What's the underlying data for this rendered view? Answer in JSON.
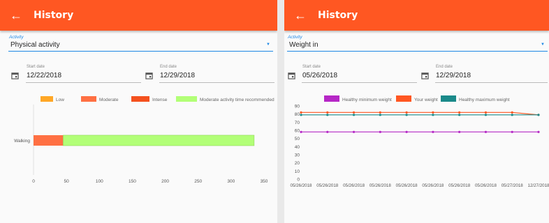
{
  "left": {
    "title": "History",
    "activity_label": "Activity",
    "activity_value": "Physical activity",
    "start_label": "Start date",
    "start_value": "12/22/2018",
    "end_label": "End date",
    "end_value": "12/29/2018",
    "chart_data": {
      "type": "bar",
      "orientation": "horizontal",
      "stacked": true,
      "categories": [
        "Walking"
      ],
      "series": [
        {
          "name": "Low",
          "color": "#ffa726",
          "values": [
            0
          ]
        },
        {
          "name": "Moderate",
          "color": "#ff7043",
          "values": [
            45
          ]
        },
        {
          "name": "Intense",
          "color": "#f4511e",
          "values": [
            0
          ]
        },
        {
          "name": "Moderate activity time recommended",
          "color": "#b2ff77",
          "values": [
            290
          ]
        }
      ],
      "xlim": [
        0,
        350
      ],
      "xticks": [
        0,
        50,
        100,
        150,
        200,
        250,
        300,
        350
      ]
    }
  },
  "right": {
    "title": "History",
    "activity_label": "Activity",
    "activity_value": "Weight in",
    "start_label": "Start date",
    "start_value": "05/26/2018",
    "end_label": "End date",
    "end_value": "12/29/2018",
    "chart_data": {
      "type": "line",
      "categories": [
        "05/26/2018",
        "05/26/2018",
        "05/26/2018",
        "05/26/2018",
        "05/26/2018",
        "05/26/2018",
        "05/26/2018",
        "05/26/2018",
        "05/27/2018",
        "12/27/2018"
      ],
      "series": [
        {
          "name": "Healthy minimum weight",
          "color": "#b627c6",
          "values": [
            58,
            58,
            58,
            58,
            58,
            58,
            58,
            58,
            58,
            58
          ]
        },
        {
          "name": "Your weight",
          "color": "#ff5722",
          "values": [
            82,
            82,
            82,
            82,
            82,
            82,
            82,
            82,
            82,
            79
          ]
        },
        {
          "name": "Healthy maximum weight",
          "color": "#1a8a8a",
          "values": [
            79,
            79,
            79,
            79,
            79,
            79,
            79,
            79,
            79,
            79
          ]
        }
      ],
      "ylim": [
        0,
        90
      ],
      "yticks": [
        0,
        10,
        20,
        30,
        40,
        50,
        60,
        70,
        80,
        90
      ]
    }
  }
}
